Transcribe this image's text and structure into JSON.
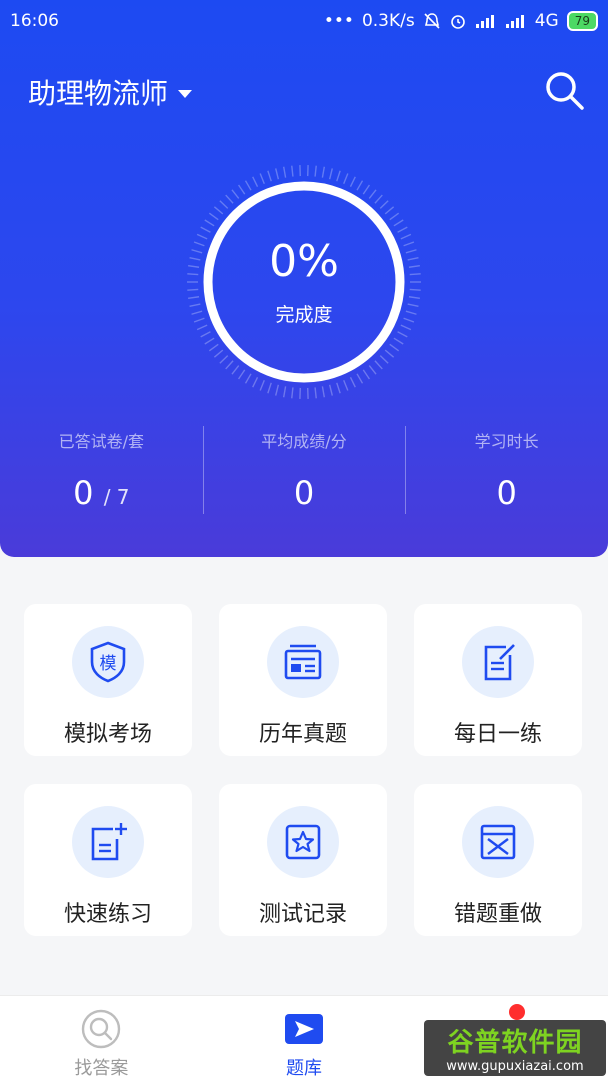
{
  "status_bar": {
    "time": "16:06",
    "dots": "•••",
    "speed": "0.3K/s",
    "network": "4G",
    "battery": "79"
  },
  "header": {
    "title": "助理物流师"
  },
  "progress": {
    "percent_text": "0%",
    "percent_value": 0,
    "label": "完成度"
  },
  "stats": [
    {
      "label": "已答试卷/套",
      "value": "0",
      "total": "/ 7"
    },
    {
      "label": "平均成绩/分",
      "value": "0"
    },
    {
      "label": "学习时长",
      "value": "0"
    }
  ],
  "menu": [
    {
      "label": "模拟考场",
      "icon": "shield-mo-icon",
      "glyph": "模"
    },
    {
      "label": "历年真题",
      "icon": "newspaper-icon"
    },
    {
      "label": "每日一练",
      "icon": "note-edit-icon"
    },
    {
      "label": "快速练习",
      "icon": "note-plus-icon"
    },
    {
      "label": "测试记录",
      "icon": "star-frame-icon"
    },
    {
      "label": "错题重做",
      "icon": "x-box-icon"
    }
  ],
  "tabbar": [
    {
      "label": "找答案",
      "icon": "search-icon",
      "active": false
    },
    {
      "label": "题库",
      "icon": "play-flag-icon",
      "active": true
    }
  ],
  "colors": {
    "brand_blue": "#1f4bf0",
    "icon_bg": "#e6effd",
    "badge_red": "#ff2e2e"
  },
  "watermark": {
    "main": "谷普软件园",
    "sub": "www.gupuxiazai.com"
  }
}
